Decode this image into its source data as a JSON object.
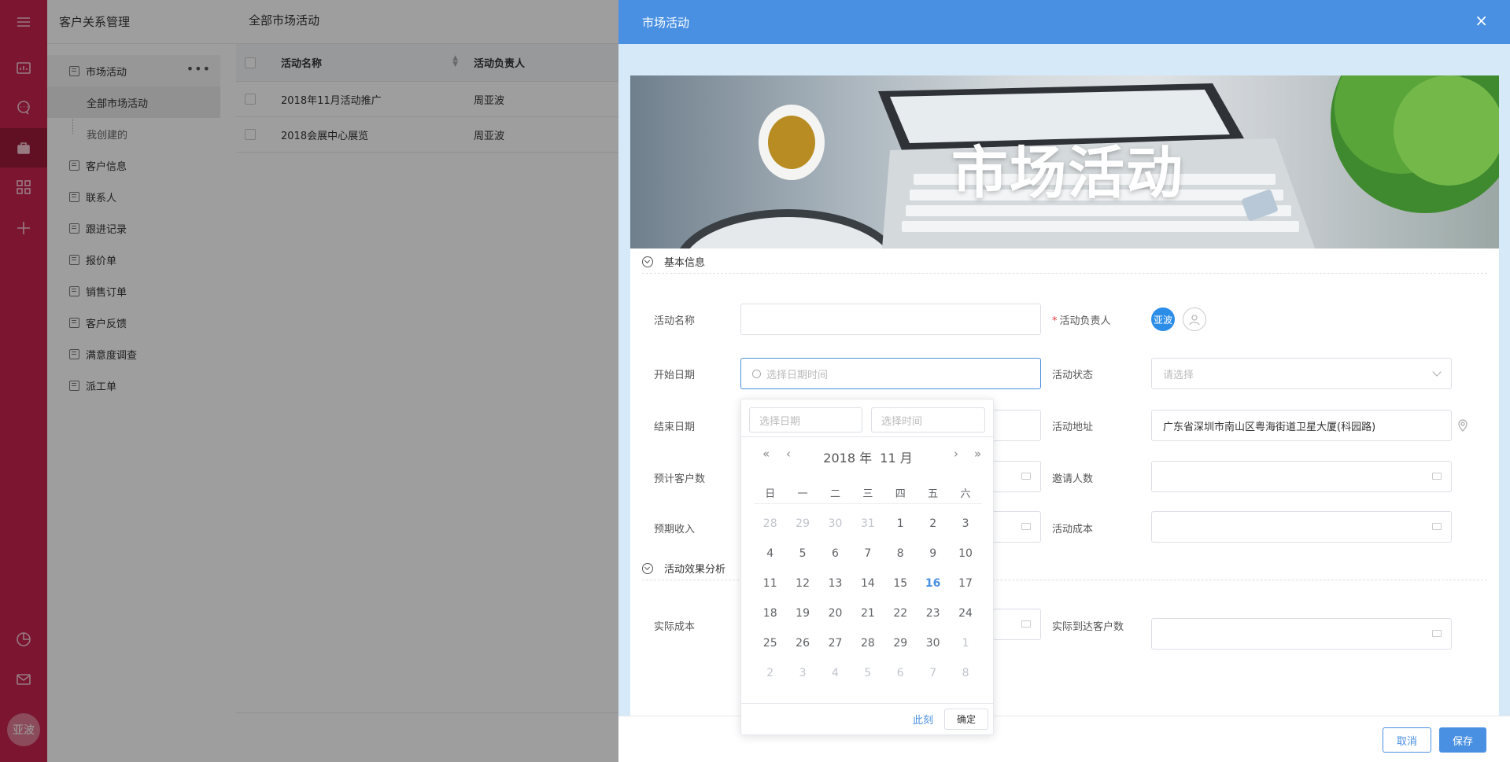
{
  "rail": {
    "avatar": "亚波"
  },
  "sidebar": {
    "title": "客户关系管理",
    "more": "•••",
    "group": "市场活动",
    "subitems": [
      "全部市场活动",
      "我创建的"
    ],
    "items": [
      "客户信息",
      "联系人",
      "跟进记录",
      "报价单",
      "销售订单",
      "客户反馈",
      "满意度调查",
      "派工单"
    ]
  },
  "content": {
    "title": "全部市场活动",
    "table": {
      "headers": [
        "活动名称",
        "活动负责人"
      ],
      "rows": [
        [
          "2018年11月活动推广",
          "周亚波"
        ],
        [
          "2018会展中心展览",
          "周亚波"
        ]
      ]
    }
  },
  "dialog": {
    "title": "市场活动",
    "close": "×",
    "banner_title": "市场活动",
    "section_basic": "基本信息",
    "section_effect": "活动效果分析",
    "fields": {
      "name_label": "活动名称",
      "owner_label": "活动负责人",
      "owner_required": "*",
      "owner_avatar": "亚波",
      "start_label": "开始日期",
      "start_placeholder": "选择日期时间",
      "status_label": "活动状态",
      "status_placeholder": "请选择",
      "end_label": "结束日期",
      "address_label": "活动地址",
      "address_value": "广东省深圳市南山区粤海街道卫星大厦(科园路)",
      "expected_customers_label": "预计客户数",
      "invitees_label": "邀请人数",
      "expected_income_label": "预期收入",
      "cost_label": "活动成本",
      "actual_cost_label": "实际成本",
      "actual_customers_label": "实际到达客户数"
    },
    "cancel": "取消",
    "save": "保存"
  },
  "picker": {
    "date_placeholder": "选择日期",
    "time_placeholder": "选择时间",
    "header": "2018 年  11 月",
    "nav_prev_year": "«",
    "nav_prev_month": "‹",
    "nav_next_month": "›",
    "nav_next_year": "»",
    "weekdays": [
      "日",
      "一",
      "二",
      "三",
      "四",
      "五",
      "六"
    ],
    "today": 16,
    "weeks": [
      [
        [
          28,
          "o"
        ],
        [
          29,
          "o"
        ],
        [
          30,
          "o"
        ],
        [
          31,
          "o"
        ],
        [
          1,
          ""
        ],
        [
          2,
          ""
        ],
        [
          3,
          ""
        ]
      ],
      [
        [
          4,
          ""
        ],
        [
          5,
          ""
        ],
        [
          6,
          ""
        ],
        [
          7,
          ""
        ],
        [
          8,
          ""
        ],
        [
          9,
          ""
        ],
        [
          10,
          ""
        ]
      ],
      [
        [
          11,
          ""
        ],
        [
          12,
          ""
        ],
        [
          13,
          ""
        ],
        [
          14,
          ""
        ],
        [
          15,
          ""
        ],
        [
          16,
          "t"
        ],
        [
          17,
          ""
        ]
      ],
      [
        [
          18,
          ""
        ],
        [
          19,
          ""
        ],
        [
          20,
          ""
        ],
        [
          21,
          ""
        ],
        [
          22,
          ""
        ],
        [
          23,
          ""
        ],
        [
          24,
          ""
        ]
      ],
      [
        [
          25,
          ""
        ],
        [
          26,
          ""
        ],
        [
          27,
          ""
        ],
        [
          28,
          ""
        ],
        [
          29,
          ""
        ],
        [
          30,
          ""
        ],
        [
          1,
          "o"
        ]
      ],
      [
        [
          2,
          "o"
        ],
        [
          3,
          "o"
        ],
        [
          4,
          "o"
        ],
        [
          5,
          "o"
        ],
        [
          6,
          "o"
        ],
        [
          7,
          "o"
        ],
        [
          8,
          "o"
        ]
      ]
    ],
    "now": "此刻",
    "ok": "确定"
  }
}
